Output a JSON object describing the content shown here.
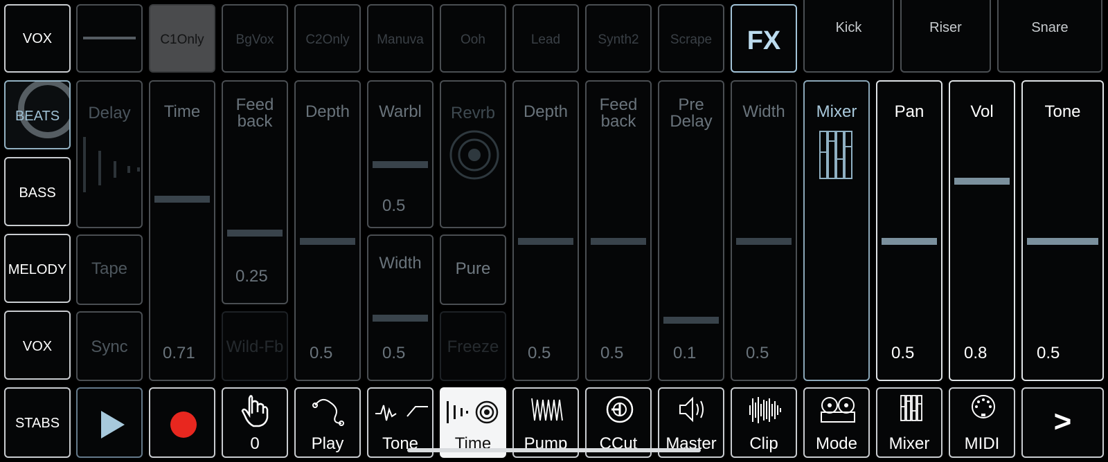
{
  "top_row": {
    "part_label": "VOX",
    "slots": [
      "",
      "C1Only",
      "BgVox",
      "C2Only",
      "Manuva",
      "Ooh",
      "Lead",
      "Synth2",
      "Scrape"
    ],
    "fx_label": "FX",
    "pads": [
      "Kick",
      "Riser",
      "Snare"
    ]
  },
  "side_parts": [
    "BEATS",
    "BASS",
    "MELODY",
    "VOX",
    "STABS"
  ],
  "delay": {
    "delay_label": "Delay",
    "tape_label": "Tape",
    "sync_label": "Sync",
    "time": {
      "label": "Time",
      "value": "0.71",
      "level": 0.71
    },
    "feedback": {
      "label": "Feed back",
      "value": "0.25",
      "level": 0.25
    },
    "wild_fb_label": "Wild-Fb",
    "depth": {
      "label": "Depth",
      "value": "0.5",
      "level": 0.5
    },
    "warble": {
      "label": "Warbl",
      "value": "0.5",
      "level": 0.5
    },
    "width": {
      "label": "Width",
      "value": "0.5",
      "level": 0.5
    }
  },
  "reverb": {
    "reverb_label": "Revrb",
    "pure_label": "Pure",
    "freeze_label": "Freeze",
    "depth": {
      "label": "Depth",
      "value": "0.5",
      "level": 0.5
    },
    "feedback": {
      "label": "Feed back",
      "value": "0.5",
      "level": 0.5
    },
    "predelay": {
      "label": "Pre Delay",
      "value": "0.1",
      "level": 0.1
    },
    "width": {
      "label": "Width",
      "value": "0.5",
      "level": 0.5
    }
  },
  "mixer": {
    "label": "Mixer",
    "pan": {
      "label": "Pan",
      "value": "0.5",
      "level": 0.5
    },
    "vol": {
      "label": "Vol",
      "value": "0.8",
      "level": 0.8
    },
    "tone": {
      "label": "Tone",
      "value": "0.5",
      "level": 0.5
    }
  },
  "bottom_bar": {
    "touch_count": "0",
    "items": [
      "Play",
      "Tone",
      "Time",
      "Pump",
      "CCut",
      "Master",
      "Clip",
      "Mode",
      "Mixer",
      "MIDI"
    ],
    "next_label": ">"
  },
  "colors": {
    "record": "#e8271f",
    "play": "#a7c9dc",
    "fx": "#bcdcef"
  }
}
